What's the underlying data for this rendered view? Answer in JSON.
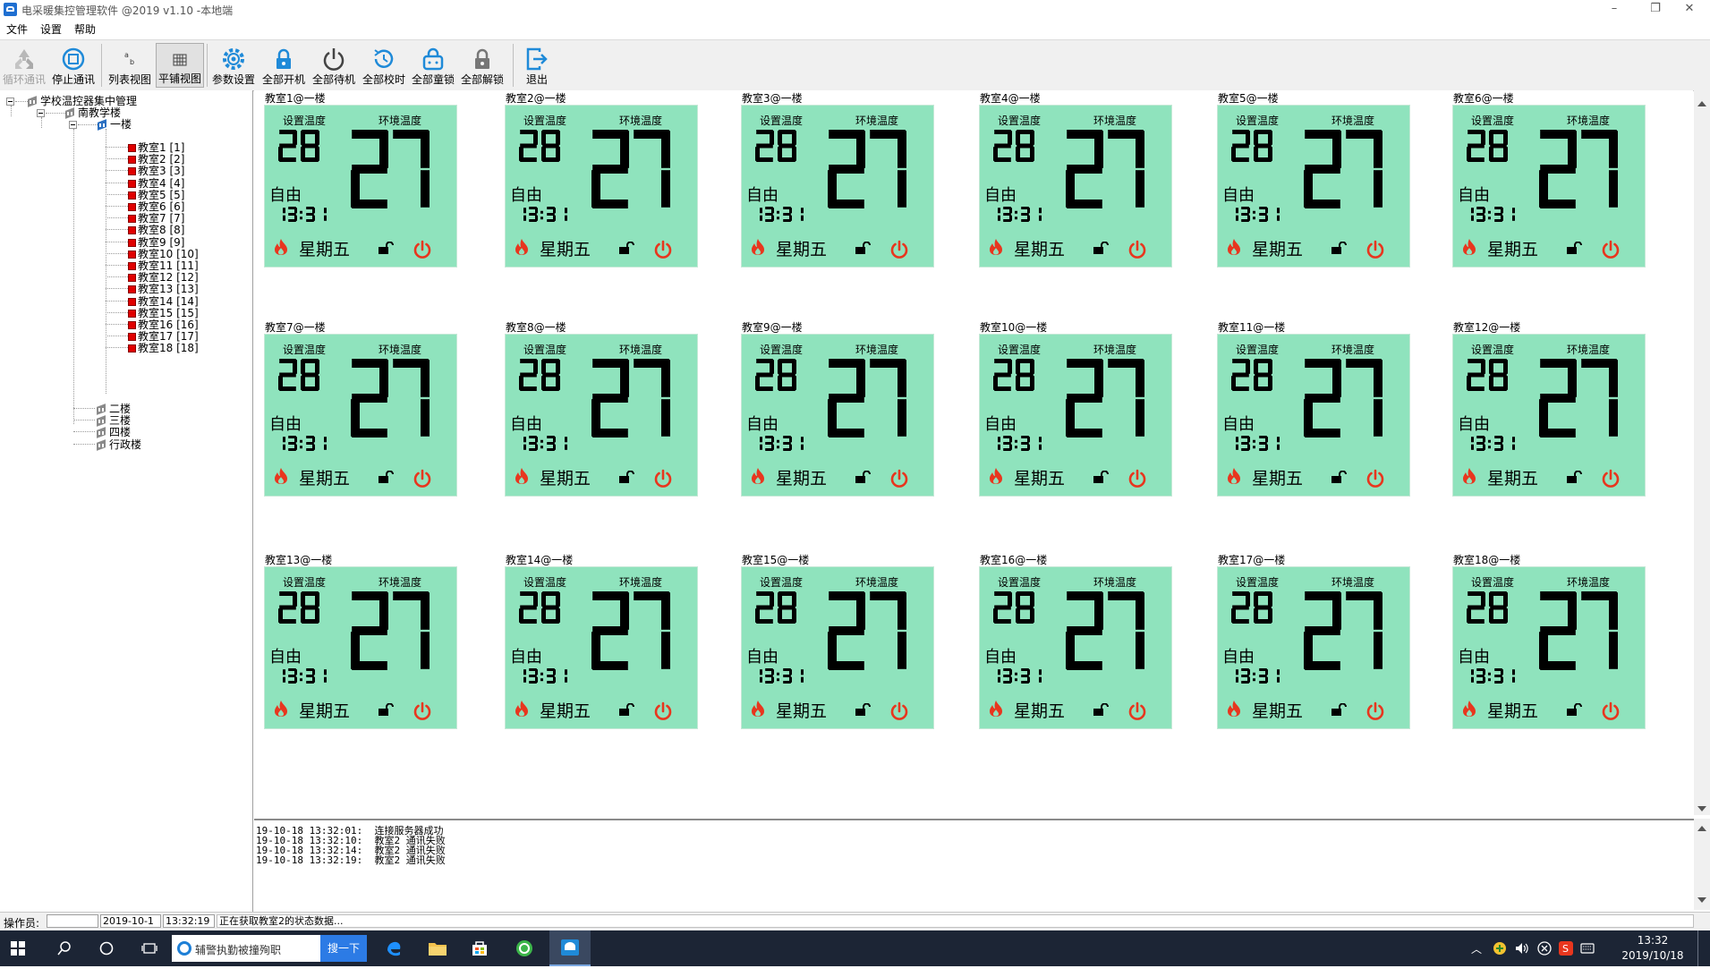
{
  "window": {
    "title": "电采暖集控管理软件 @2019  v1.10 -本地端",
    "controls": [
      "–",
      "❐",
      "✕"
    ]
  },
  "menu": [
    "文件",
    "设置",
    "帮助"
  ],
  "toolbar": [
    {
      "label": "循环通讯",
      "icon": "recycle-icon",
      "disabled": true
    },
    {
      "label": "停止通讯",
      "icon": "stop-comm-icon"
    },
    {
      "label": "列表视图",
      "icon": "list-view-icon"
    },
    {
      "label": "平铺视图",
      "icon": "tile-view-icon",
      "active": true
    },
    {
      "label": "参数设置",
      "icon": "gear-icon"
    },
    {
      "label": "全部开机",
      "icon": "unlock-icon"
    },
    {
      "label": "全部待机",
      "icon": "power-icon"
    },
    {
      "label": "全部校时",
      "icon": "clock-sync-icon"
    },
    {
      "label": "全部童锁",
      "icon": "child-lock-icon"
    },
    {
      "label": "全部解锁",
      "icon": "lock-icon"
    },
    {
      "label": "退出",
      "icon": "exit-icon"
    }
  ],
  "tree": {
    "root": "学校温控器集中管理",
    "building": "南教学楼",
    "floor": "一楼",
    "rooms": [
      "教室1 [1]",
      "教室2 [2]",
      "教室3 [3]",
      "教室4 [4]",
      "教室5 [5]",
      "教室6 [6]",
      "教室7 [7]",
      "教室8 [8]",
      "教室9 [9]",
      "教室10 [10]",
      "教室11 [11]",
      "教室12 [12]",
      "教室13 [13]",
      "教室14 [14]",
      "教室15 [15]",
      "教室16 [16]",
      "教室17 [17]",
      "教室18 [18]"
    ],
    "other_floors": [
      "二楼",
      "三楼",
      "四楼",
      "行政楼"
    ]
  },
  "thermostat_common": {
    "set_label": "设置温度",
    "ambient_label": "环境温度",
    "set_temp": "28",
    "ambient_temp": "27",
    "mode": "自由",
    "time": "13:31",
    "weekday": "星期五",
    "lcd_color": "#8fe3bd",
    "icon_color": "#e8361e"
  },
  "thermostats": [
    {
      "title": "教室1@一楼"
    },
    {
      "title": "教室2@一楼"
    },
    {
      "title": "教室3@一楼"
    },
    {
      "title": "教室4@一楼"
    },
    {
      "title": "教室5@一楼"
    },
    {
      "title": "教室6@一楼"
    },
    {
      "title": "教室7@一楼"
    },
    {
      "title": "教室8@一楼"
    },
    {
      "title": "教室9@一楼"
    },
    {
      "title": "教室10@一楼"
    },
    {
      "title": "教室11@一楼"
    },
    {
      "title": "教室12@一楼"
    },
    {
      "title": "教室13@一楼"
    },
    {
      "title": "教室14@一楼"
    },
    {
      "title": "教室15@一楼"
    },
    {
      "title": "教室16@一楼"
    },
    {
      "title": "教室17@一楼"
    },
    {
      "title": "教室18@一楼"
    }
  ],
  "log": [
    "19-10-18 13:32:01:  连接服务器成功",
    "19-10-18 13:32:10:  教室2 通讯失败",
    "19-10-18 13:32:14:  教室2 通讯失败",
    "19-10-18 13:32:19:  教室2 通讯失败"
  ],
  "status": {
    "operator_label": "操作员:",
    "operator_value": "",
    "date": "2019-10-1",
    "time": "13:32:19",
    "message": "正在获取教室2的状态数据..."
  },
  "taskbar": {
    "search_text": "辅警执勤被撞殉职",
    "search_button": "搜一下",
    "clock_time": "13:32",
    "clock_date": "2019/10/18"
  }
}
